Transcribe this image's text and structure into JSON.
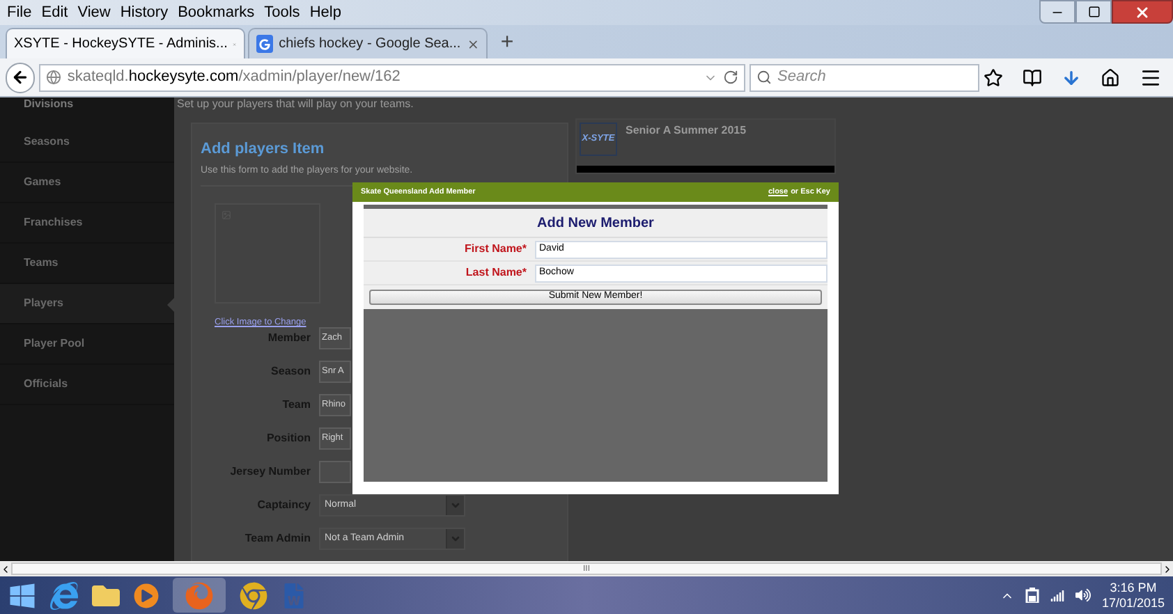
{
  "menu_bar": [
    "File",
    "Edit",
    "View",
    "History",
    "Bookmarks",
    "Tools",
    "Help"
  ],
  "tabs": [
    {
      "label": "XSYTE - HockeySYTE - Adminis...",
      "selected": true
    },
    {
      "label": "chiefs hockey - Google Sea...",
      "selected": false
    }
  ],
  "new_tab": "+",
  "address_bar": {
    "url": "skateqld.**hockeysyte.com**/xadmin/player/new/162"
  },
  "search": {
    "placeholder": "Search"
  },
  "page_header": {
    "sidebar_item": "Divisions",
    "subtitle": "Set up your players that will play on your teams."
  },
  "sidebar": {
    "items": [
      {
        "label": "Seasons",
        "selected": false
      },
      {
        "label": "Games",
        "selected": false
      },
      {
        "label": "Franchises",
        "selected": false
      },
      {
        "label": "Teams",
        "selected": false
      },
      {
        "label": "Players",
        "selected": true
      },
      {
        "label": "Player Pool",
        "selected": false
      },
      {
        "label": "Officials",
        "selected": false
      }
    ]
  },
  "form": {
    "title": "Add players Item",
    "description": "Use this form to add the players for your website.",
    "image_link": "Click Image to Change",
    "fields": [
      {
        "label": "Member",
        "kind": "text",
        "value": "Zach"
      },
      {
        "label": "Season",
        "kind": "text",
        "value": "Snr A"
      },
      {
        "label": "Team",
        "kind": "text",
        "value": "Rhino"
      },
      {
        "label": "Position",
        "kind": "text",
        "value": "Right"
      },
      {
        "label": "Jersey Number",
        "kind": "text"
      },
      {
        "label": "Captaincy",
        "kind": "select",
        "value": "Normal"
      },
      {
        "label": "Team Admin",
        "kind": "select",
        "value": "Not a Team Admin"
      }
    ]
  },
  "season_card": {
    "logo": "X-SYTE",
    "title": "Senior A Summer 2015"
  },
  "modal": {
    "title": "Skate Queensland Add Member",
    "close_link": "close",
    "close_hint": "or Esc Key",
    "heading": "Add New Member",
    "fields": [
      {
        "label": "First Name*",
        "value": "David"
      },
      {
        "label": "Last Name*",
        "value": "Bochow"
      }
    ],
    "submit": "Submit New Member!"
  },
  "scrollbar": {
    "grip": "III"
  },
  "taskbar": {
    "time": "3:16 PM",
    "date": "17/01/2015"
  }
}
